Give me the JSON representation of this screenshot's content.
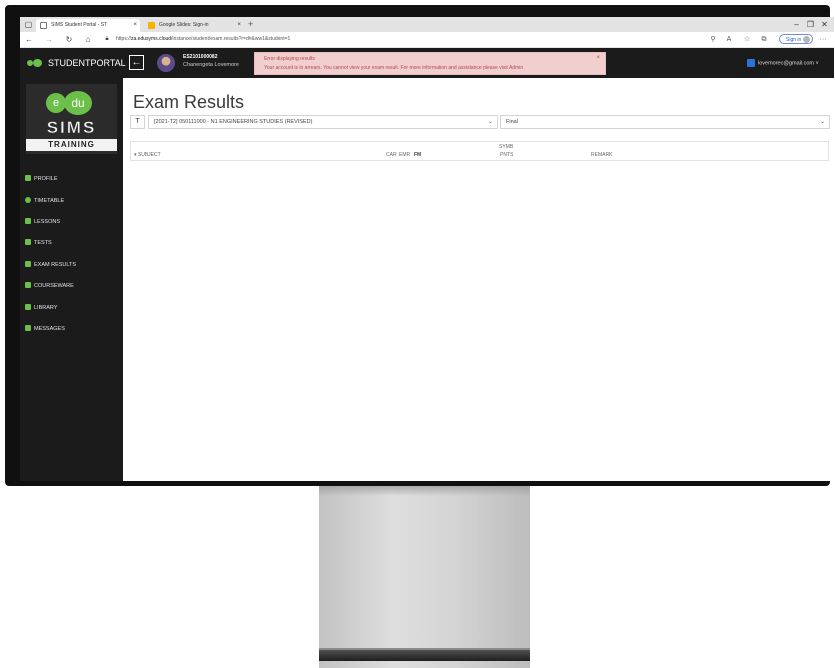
{
  "browser": {
    "tabs": [
      {
        "title": "SIMS Student Portal - ST",
        "close": "×"
      },
      {
        "title": "Google Slides: Sign-in",
        "close": "×"
      }
    ],
    "new_tab": "+",
    "url_prefix": "https://",
    "url_host": "za.edusyms.cloud",
    "url_path": "/instance/student/exam.results?r=d#&ww1&student=1",
    "signin_label": "Sign in"
  },
  "header": {
    "brand": "STUDENTPORTAL",
    "student_id": "ES2101000082",
    "student_name": "Chanengeta Lovemore",
    "user_email": "lovemorec@gmail.com ˅"
  },
  "error": {
    "title": "Error displaying results",
    "message": "Your account is in arrears. You cannot view your exam result. For more information and assistance please visit Admin",
    "close": "×"
  },
  "sidebar": {
    "logo_left": "e",
    "logo_right": "du",
    "logo_sims": "SIMS",
    "logo_training": "TRAINING",
    "items": [
      {
        "label": "PROFILE"
      },
      {
        "label": "TIMETABLE"
      },
      {
        "label": "LESSONS"
      },
      {
        "label": "TESTS"
      },
      {
        "label": "EXAM RESULTS"
      },
      {
        "label": "COURSEWARE"
      },
      {
        "label": "LIBRARY"
      },
      {
        "label": "MESSAGES"
      }
    ]
  },
  "main": {
    "title": "Exam Results",
    "course_select": "[2021-T2] 050111000 - N1 ENGINEERING STUDIES (REVISED)",
    "exam_select": "Final",
    "table_headers": {
      "subject": "SUBJECT",
      "car": "CAR",
      "emr": "EMR",
      "fm": "FM",
      "symb_1": "SYMB",
      "symb_2": "PNTS",
      "remark": "REMARK"
    }
  },
  "colors": {
    "brand_green": "#6cc04a",
    "sidebar_bg": "#1b1b1b",
    "error_bg": "#f1cfcf",
    "error_text": "#b24949"
  }
}
